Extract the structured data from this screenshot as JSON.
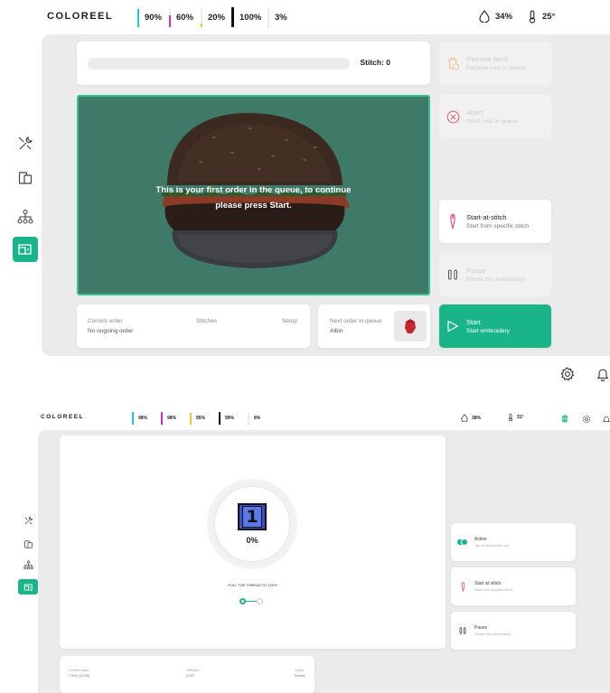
{
  "colors": {
    "accent": "#1ab38a",
    "preview_bg": "#3e7a67",
    "preview_border": "#35c48f"
  },
  "screen1": {
    "brand": "COLOREEL",
    "inks": [
      {
        "label": "90%",
        "level": 0.9,
        "color": "#1fc8d8"
      },
      {
        "label": "60%",
        "level": 0.6,
        "color": "#d22fc8"
      },
      {
        "label": "20%",
        "level": 0.2,
        "color": "#f4c531"
      },
      {
        "label": "100%",
        "level": 1.0,
        "color": "#111111"
      },
      {
        "label": "3%",
        "level": 0.03,
        "color": "#cccccc"
      }
    ],
    "humidity": "34%",
    "temperature": "25°",
    "progress": {
      "stitch_label": "Stitch: 0",
      "fraction": 0
    },
    "preview_message_line1": "This is your first order in the queue, to continue",
    "preview_message_line2": "please press Start.",
    "actions": {
      "remove_next": {
        "title": "Remove Next",
        "subtitle": "Remove next in queue",
        "icon": "trash-clock-icon"
      },
      "abort": {
        "title": "Abort",
        "subtitle": "Abort next in queue",
        "icon": "x-circle-icon"
      },
      "start_at_stitch": {
        "title": "Start-at-stitch",
        "subtitle": "Start from specific stitch",
        "icon": "needle-icon"
      },
      "pause": {
        "title": "Pause",
        "subtitle": "Pause this embroidery",
        "icon": "pause-icon"
      },
      "start": {
        "title": "Start",
        "subtitle": "Start embroidery",
        "icon": "play-icon"
      }
    },
    "current_order": {
      "label": "Current order",
      "value": "No ongoing order"
    },
    "stitches_label": "Stitches",
    "setup_label": "Setup",
    "next_order": {
      "label": "Next order in queue",
      "value": "Albin"
    },
    "sidebar": [
      "tools-icon",
      "layers-icon",
      "network-icon",
      "machine-icon"
    ]
  },
  "screen2": {
    "brand": "COLOREEL",
    "inks": [
      {
        "label": "98%",
        "level": 0.98,
        "color": "#1fc8d8"
      },
      {
        "label": "98%",
        "level": 0.98,
        "color": "#d22fc8"
      },
      {
        "label": "95%",
        "level": 0.95,
        "color": "#f4c531"
      },
      {
        "label": "99%",
        "level": 0.99,
        "color": "#111111"
      },
      {
        "label": "8%",
        "level": 0.08,
        "color": "#cccccc"
      }
    ],
    "humidity": "38%",
    "temperature": "31°",
    "counter_digit": "1",
    "percent": "0%",
    "thread_instruction": "PULL THE THREAD TO 100%",
    "actions": {
      "active": {
        "title": "Active",
        "subtitle": "Tap to deactivate unit"
      },
      "start_at_stitch": {
        "title": "Start at stitch",
        "subtitle": "Start from specific stitch"
      },
      "pause": {
        "title": "Pause",
        "subtitle": "Pause this embroidery"
      }
    },
    "current_order": {
      "label": "Current order",
      "value": "7 Test (1/100)"
    },
    "stitches": {
      "label": "Stitches",
      "value": "2020"
    },
    "setup": {
      "label": "Setup",
      "value": "Ready"
    }
  }
}
